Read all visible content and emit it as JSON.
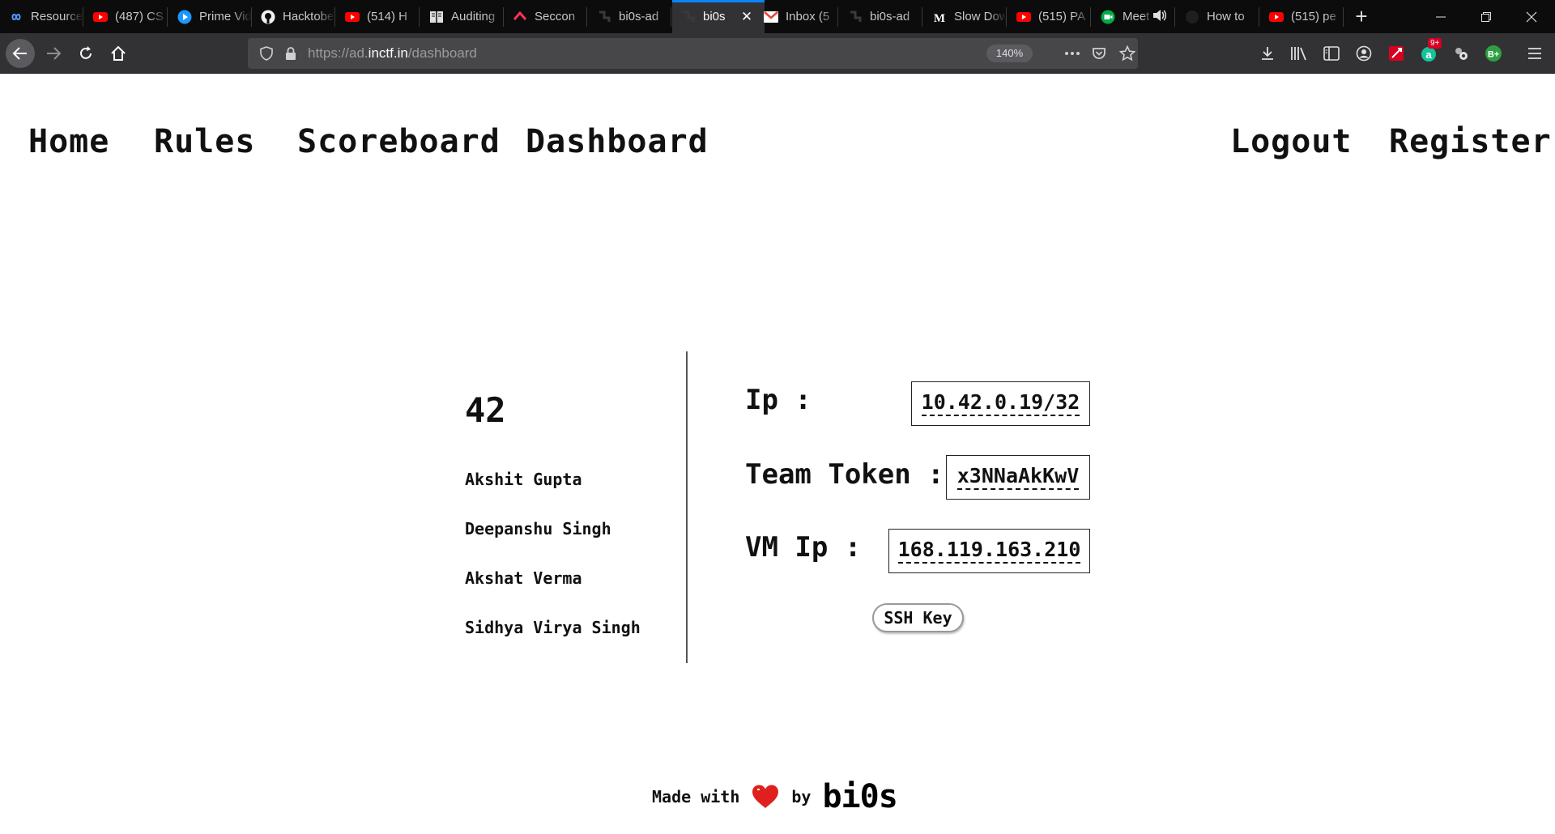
{
  "browser": {
    "tabs": [
      {
        "title": "Resources",
        "favicon": "infinity-icon",
        "active": false
      },
      {
        "title": "(487) CS",
        "favicon": "youtube-icon",
        "active": false
      },
      {
        "title": "Prime Video",
        "favicon": "prime-video-icon",
        "active": false
      },
      {
        "title": "Hacktoberfest",
        "favicon": "github-icon",
        "active": false
      },
      {
        "title": "(514) H",
        "favicon": "youtube-icon",
        "active": false
      },
      {
        "title": "Auditing",
        "favicon": "book-icon",
        "active": false
      },
      {
        "title": "Seccon",
        "favicon": "seccon-icon",
        "active": false
      },
      {
        "title": "bi0s-ad",
        "favicon": "bi0s-icon",
        "active": false
      },
      {
        "title": "bi0s",
        "favicon": "bi0s-icon",
        "active": true
      },
      {
        "title": "Inbox (5",
        "favicon": "gmail-icon",
        "active": false
      },
      {
        "title": "bi0s-ad",
        "favicon": "bi0s-icon",
        "active": false
      },
      {
        "title": "Slow Dow",
        "favicon": "medium-icon",
        "active": false
      },
      {
        "title": "(515) PA",
        "favicon": "youtube-icon",
        "active": false
      },
      {
        "title": "Meet",
        "favicon": "meet-icon",
        "active": false
      },
      {
        "title": "How to",
        "favicon": "dark-icon",
        "active": false
      },
      {
        "title": "(515) pe",
        "favicon": "youtube-icon",
        "active": false
      }
    ],
    "url_prefix": "https://ad.",
    "url_domain": "inctf.in",
    "url_path": "/dashboard",
    "zoom": "140%",
    "extension_badge": "9+"
  },
  "nav": {
    "home": "Home",
    "rules": "Rules",
    "scoreboard": "Scoreboard",
    "dashboard": "Dashboard",
    "logout": "Logout",
    "register": "Register"
  },
  "team": {
    "name": "42",
    "members": [
      "Akshit Gupta",
      "Deepanshu Singh",
      "Akshat Verma",
      "Sidhya Virya Singh"
    ]
  },
  "info": {
    "ip_label": "Ip :",
    "ip_value": "10.42.0.19/32",
    "token_label": "Team Token :",
    "token_value": "x3NNaAkKwV",
    "vm_ip_label": "VM Ip :",
    "vm_ip_value": "168.119.163.210",
    "ssh_button": "SSH Key"
  },
  "footer": {
    "made_with": "Made with",
    "by": "by",
    "brand": "bi0s",
    "heart_color": "#e0201e"
  }
}
